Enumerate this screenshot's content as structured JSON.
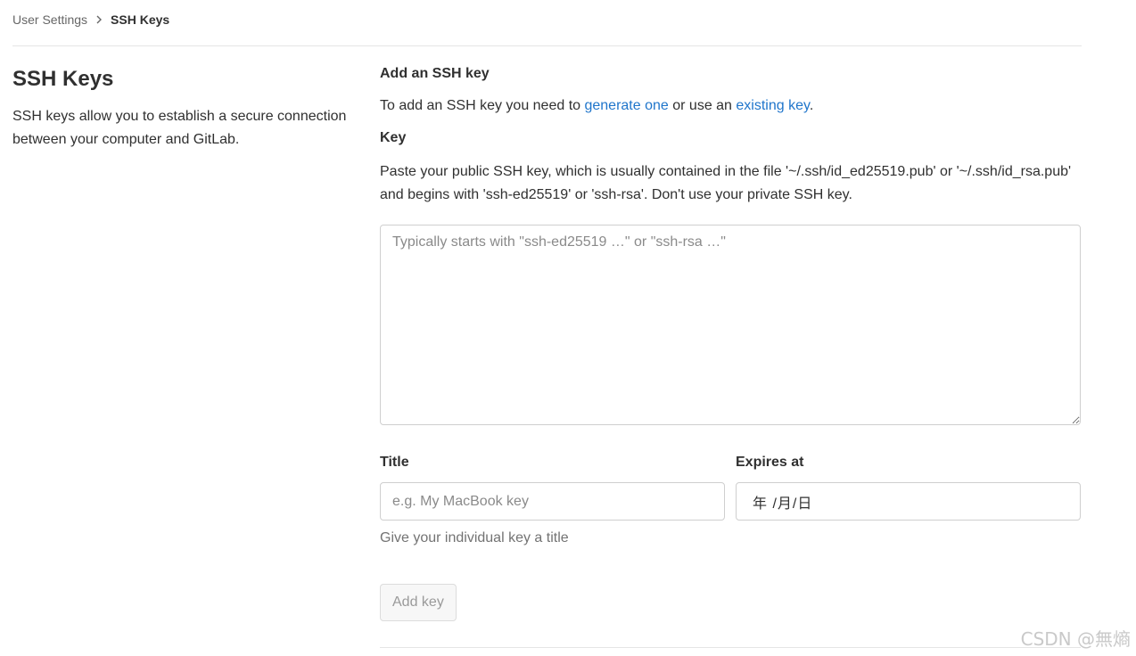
{
  "breadcrumb": {
    "parent": "User Settings",
    "current": "SSH Keys"
  },
  "left": {
    "title": "SSH Keys",
    "description": "SSH keys allow you to establish a secure connection between your computer and GitLab."
  },
  "form": {
    "heading": "Add an SSH key",
    "intro": {
      "prefix": "To add an SSH key you need to ",
      "link_generate": "generate one",
      "middle": " or use an ",
      "link_existing": "existing key",
      "suffix": "."
    },
    "key": {
      "label": "Key",
      "help": "Paste your public SSH key, which is usually contained in the file '~/.ssh/id_ed25519.pub' or '~/.ssh/id_rsa.pub' and begins with 'ssh-ed25519' or 'ssh-rsa'. Don't use your private SSH key.",
      "value": "",
      "placeholder": "Typically starts with \"ssh-ed25519 …\" or \"ssh-rsa …\""
    },
    "title": {
      "label": "Title",
      "value": "",
      "placeholder": "e.g. My MacBook key",
      "hint": "Give your individual key a title"
    },
    "expires": {
      "label": "Expires at",
      "value": "年 /月/日"
    },
    "submit_label": "Add key"
  },
  "watermark": "CSDN @無熵",
  "icons": {
    "breadcrumb_separator": "chevron-right-icon"
  },
  "colors": {
    "link": "#1f75cb",
    "text": "#303030",
    "muted": "#737373",
    "border": "#cfcfcf"
  }
}
